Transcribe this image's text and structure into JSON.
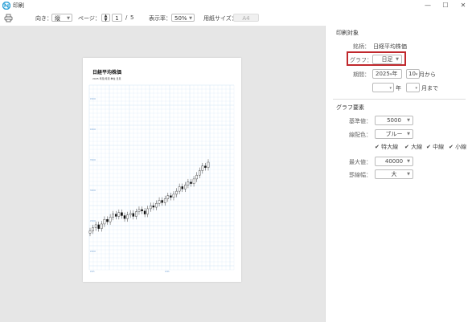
{
  "window": {
    "title": "印刷"
  },
  "toolbar": {
    "orientation_label": "向き：",
    "orientation_value": "縦",
    "page_label": "ページ：",
    "page_current": "1",
    "page_sep": "/",
    "page_total": "5",
    "zoom_label": "表示率：",
    "zoom_value": "50%",
    "paper_label": "用紙サイズ：",
    "paper_value": "A4"
  },
  "preview": {
    "title": "日経平均株価",
    "subtitle": "2025 年足/月足 単位 日足",
    "ytick_labels": [
      "45000",
      "40000",
      "35000",
      "30000",
      "25000",
      "20000",
      "15000"
    ],
    "xtick_labels": [
      "2025",
      "2026"
    ]
  },
  "panel": {
    "print_target": {
      "title": "印刷対象",
      "stock_label": "銘柄：",
      "stock_value": "日経平均株価",
      "graph_label": "グラフ：",
      "graph_value": "日足",
      "period_label": "期間：",
      "year_from": "2025",
      "year_unit": "年",
      "month_from": "10",
      "month_from_suffix": "月から",
      "year_to": "",
      "month_to": "",
      "month_to_suffix": "月まで"
    },
    "graph_elements": {
      "title": "グラフ要素",
      "base_label": "基準値：",
      "base_value": "5000",
      "color_label": "線配色：",
      "color_value": "ブルー",
      "check_extra_thick": "特大線",
      "check_thick": "大線",
      "check_medium": "中線",
      "check_thin": "小線",
      "max_label": "最大値：",
      "max_value": "40000",
      "scale_label": "罫線幅：",
      "scale_value": "大"
    }
  },
  "colors": {
    "highlight": "#c0282d",
    "grid": "#cfe3f5",
    "accent": "#2a7fd4"
  },
  "chart_data": {
    "type": "candlestick",
    "title": "日経平均株価",
    "note": "approximate price trend read from thumbnail",
    "values": [
      15000,
      15400,
      15800,
      15300,
      15900,
      16500,
      16200,
      16800,
      17200,
      16900,
      17400,
      17000,
      16600,
      17100,
      17300,
      16900,
      17500,
      17800,
      17600,
      17200,
      17900,
      18300,
      18100,
      18600,
      19000,
      18700,
      19200,
      19600,
      19400,
      19800,
      20200,
      20800,
      20500,
      21000,
      21400,
      21200,
      21800,
      22300,
      22900,
      23500,
      23300,
      24000
    ]
  }
}
